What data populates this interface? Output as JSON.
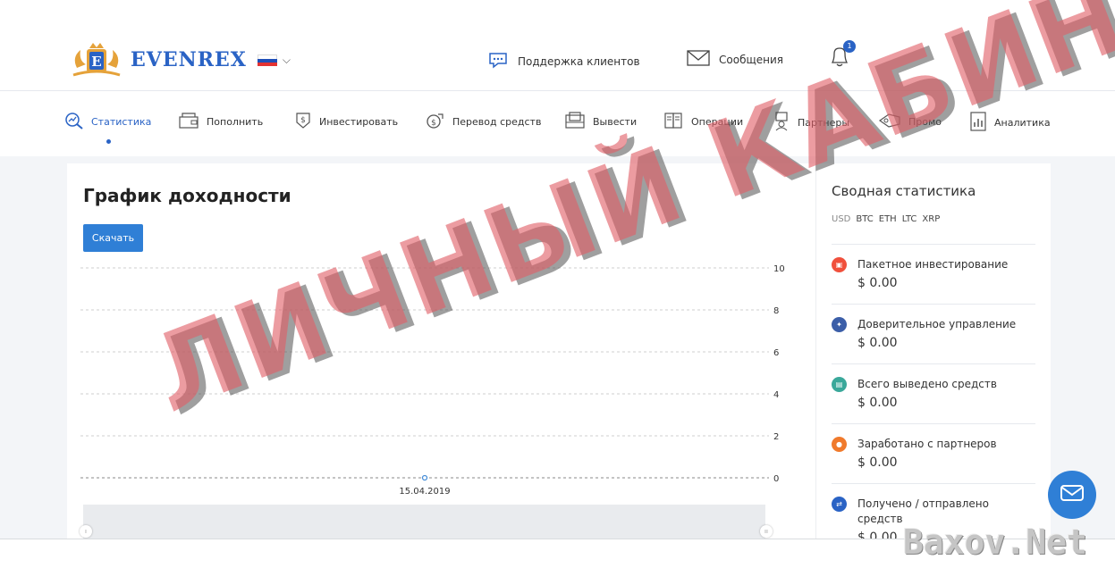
{
  "header": {
    "logo_text": "EVENREX",
    "support_label": "Поддержка клиентов",
    "messages_label": "Сообщения",
    "notification_count": "1"
  },
  "nav": {
    "items": [
      {
        "label": "Статистика",
        "icon": "stats-icon",
        "active": true
      },
      {
        "label": "Пополнить",
        "icon": "wallet-icon"
      },
      {
        "label": "Инвестировать",
        "icon": "invest-icon"
      },
      {
        "label": "Перевод средств",
        "icon": "transfer-icon"
      },
      {
        "label": "Вывести",
        "icon": "withdraw-icon"
      },
      {
        "label": "Операции",
        "icon": "operations-icon"
      },
      {
        "label": "Партнеры",
        "icon": "partners-icon"
      },
      {
        "label": "Промо",
        "icon": "promo-icon"
      },
      {
        "label": "Аналитика",
        "icon": "analytics-icon"
      }
    ]
  },
  "main": {
    "title": "График доходности",
    "download_label": "Скачать"
  },
  "chart_data": {
    "type": "line",
    "x": [
      "15.04.2019"
    ],
    "series": [
      {
        "values": [
          0
        ]
      }
    ],
    "y_ticks": [
      "10",
      "8",
      "6",
      "4",
      "2",
      "0"
    ],
    "ylim": [
      0,
      10
    ],
    "grid": true,
    "color": "#4a90d9"
  },
  "sidebar": {
    "title": "Сводная статистика",
    "currencies": [
      "USD",
      "BTC",
      "ETH",
      "LTC",
      "XRP"
    ],
    "items": [
      {
        "label": "Пакетное инвестирование",
        "value": "$ 0.00",
        "color": "#f0503c"
      },
      {
        "label": "Доверительное управление",
        "value": "$ 0.00",
        "color": "#3b5ea8"
      },
      {
        "label": "Всего выведено средств",
        "value": "$ 0.00",
        "color": "#3aa89a"
      },
      {
        "label": "Заработано с партнеров",
        "value": "$ 0.00",
        "color": "#f07a2c"
      },
      {
        "label": "Получено / отправлено средств",
        "value": "$ 0.00",
        "color": "#2a63c5"
      }
    ]
  },
  "watermark": {
    "text": "ЛИЧНЫЙ КАБИНЕТ",
    "site": "Baxov.Net"
  },
  "colors": {
    "accent": "#2a63c5",
    "button": "#2f7fd6"
  }
}
